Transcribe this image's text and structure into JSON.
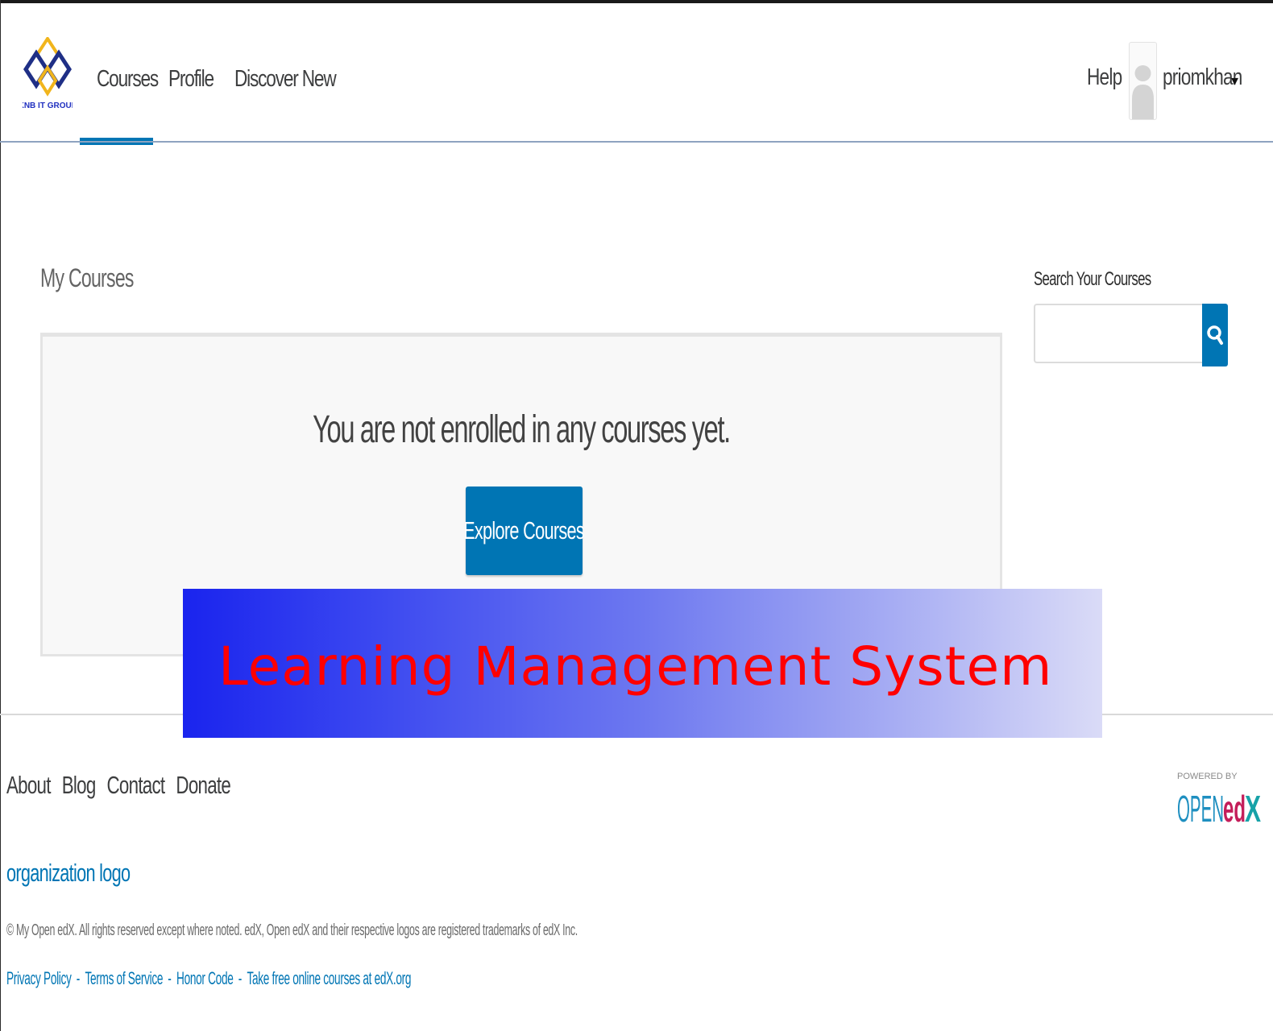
{
  "header": {
    "logo_text": "KNB IT GROUP",
    "nav": [
      {
        "label": "Courses",
        "active": true
      },
      {
        "label": "Profile",
        "active": false
      },
      {
        "label": "Discover New",
        "active": false
      }
    ],
    "help": "Help",
    "username": "priomkhan",
    "menu_caret": "▾",
    "accent_color": "#0075b4"
  },
  "main": {
    "title": "My Courses",
    "empty_message": "You are not enrolled in any courses yet.",
    "explore_button": "Explore Courses",
    "search": {
      "label": "Search Your Courses",
      "value": "",
      "placeholder": "",
      "button_icon": "search-icon"
    }
  },
  "banner": {
    "text": "Learning Management System",
    "text_color": "#ff0000"
  },
  "footer": {
    "nav": [
      "About",
      "Blog",
      "Contact",
      "Donate"
    ],
    "org_logo": "organization logo",
    "copyright": "© My Open edX. All rights reserved except where noted. edX, Open edX and their respective logos are registered trademarks of edX Inc.",
    "legal": [
      "Privacy Policy",
      "Terms of Service",
      "Honor Code",
      "Take free online courses at edX.org"
    ],
    "legal_separator": "-",
    "powered_by": {
      "caption": "POWERED BY",
      "brand_open": "OPEN",
      "brand_ed": "ed",
      "brand_x": "X"
    }
  }
}
